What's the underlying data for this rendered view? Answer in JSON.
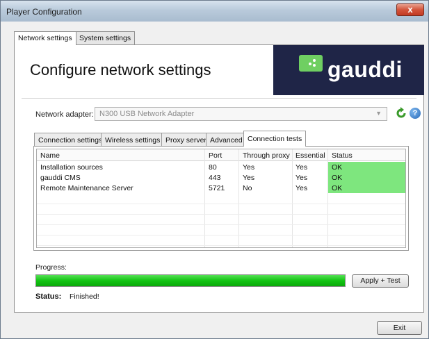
{
  "window": {
    "title": "Player Configuration",
    "close_label": "x"
  },
  "outer_tabs": [
    {
      "label": "Network settings",
      "active": true
    },
    {
      "label": "System settings",
      "active": false
    }
  ],
  "header": {
    "title": "Configure network settings",
    "logo_text": "gauddi",
    "logo_bg": "#1f2547",
    "logo_accent": "#6fcf62"
  },
  "adapter": {
    "label": "Network adapter:",
    "value": "N300 USB Network Adapter",
    "icons": [
      "chevron-down-icon",
      "refresh-icon",
      "help-icon"
    ],
    "help_glyph": "?"
  },
  "inner_tabs": [
    {
      "label": "Connection settings",
      "active": false
    },
    {
      "label": "Wireless settings",
      "active": false
    },
    {
      "label": "Proxy server",
      "active": false
    },
    {
      "label": "Advanced",
      "active": false
    },
    {
      "label": "Connection tests",
      "active": true
    }
  ],
  "table": {
    "columns": [
      "Name",
      "Port",
      "Through proxy",
      "Essential",
      "Status"
    ],
    "rows": [
      {
        "name": "Installation sources",
        "port": "80",
        "proxy": "Yes",
        "essential": "Yes",
        "status": "OK"
      },
      {
        "name": "gauddi CMS",
        "port": "443",
        "proxy": "Yes",
        "essential": "Yes",
        "status": "OK"
      },
      {
        "name": "Remote Maintenance Server",
        "port": "5721",
        "proxy": "No",
        "essential": "Yes",
        "status": "OK"
      }
    ],
    "status_color": "#7ee67e"
  },
  "progress": {
    "label": "Progress:",
    "value_percent": 100,
    "apply_label": "Apply + Test"
  },
  "status": {
    "key": "Status:",
    "value": "Finished!"
  },
  "footer": {
    "exit_label": "Exit"
  }
}
